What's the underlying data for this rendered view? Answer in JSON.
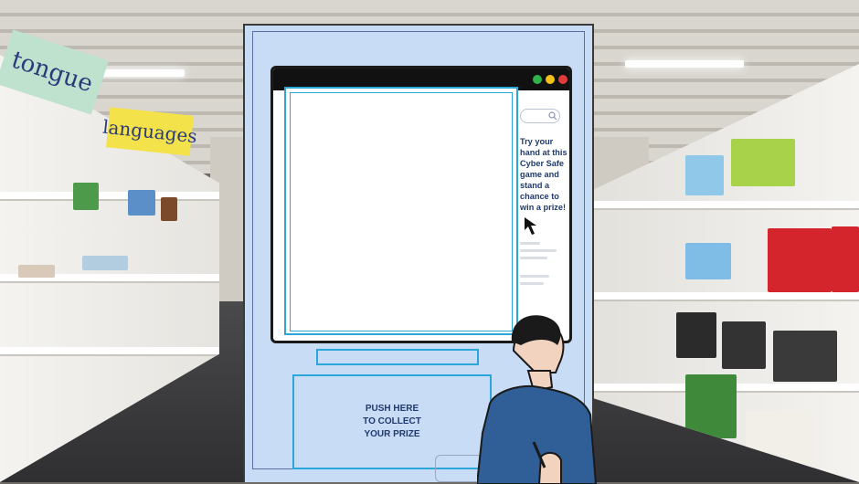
{
  "scene": {
    "sign_left_top": "tongue",
    "sign_left_mid": "languages"
  },
  "kiosk": {
    "promo_text": "Try your hand at this Cyber Safe game and stand a chance to win a prize!",
    "prize_button_label": "PUSH HERE TO COLLECT YOUR PRIZE",
    "window_dots": [
      "#2db34a",
      "#f2c21b",
      "#e23b3b"
    ]
  }
}
